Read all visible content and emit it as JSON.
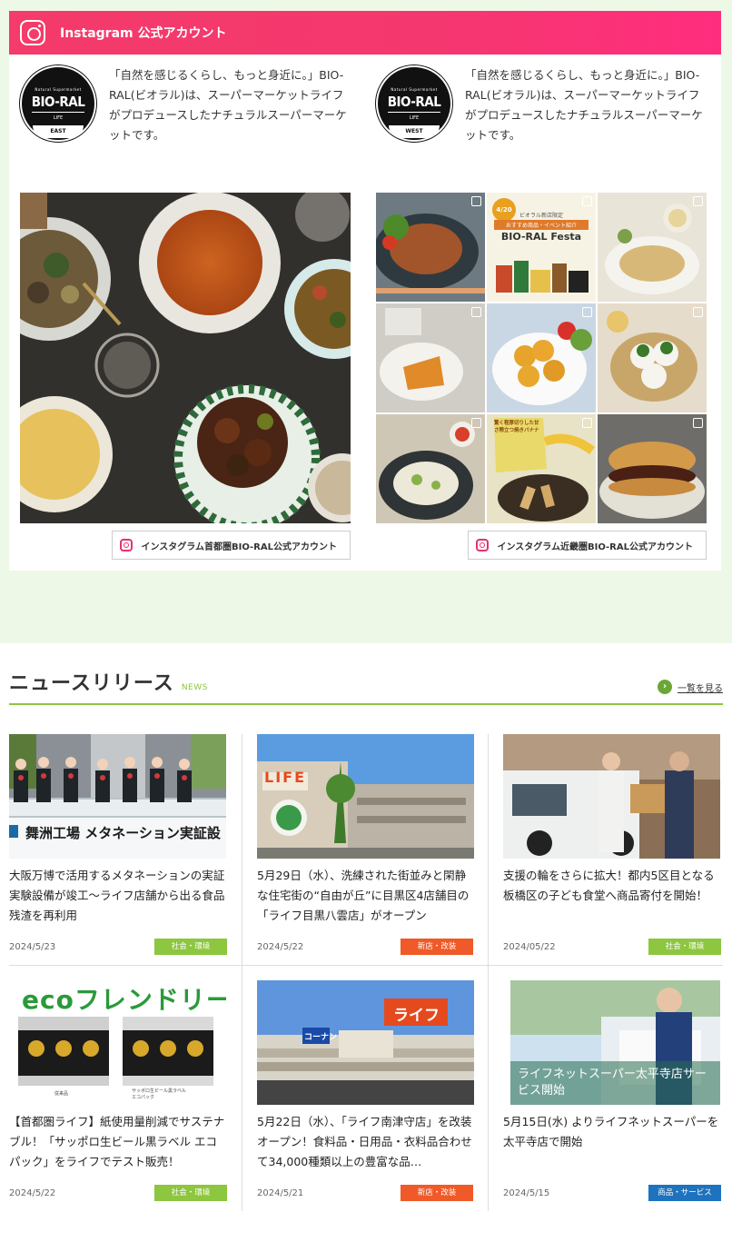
{
  "instagram": {
    "title": "Instagram 公式アカウント",
    "accounts": [
      {
        "logo_small": "Natural Supermarket",
        "logo_main": "BIO-RAL",
        "logo_life": "LIFE",
        "logo_tag": "EAST",
        "description": "「自然を感じるくらし、もっと身近に。」BIO-RAL(ビオラル)は、スーパーマーケットライフがプロデュースしたナチュラルスーパーマーケットです。",
        "link_label": "インスタグラム首都圏BIO-RAL公式アカウント"
      },
      {
        "logo_small": "Natural Supermarket",
        "logo_main": "BIO-RAL",
        "logo_life": "LIFE",
        "logo_tag": "WEST",
        "description": "「自然を感じるくらし、もっと身近に。」BIO-RAL(ビオラル)は、スーパーマーケットライフがプロデュースしたナチュラルスーパーマーケットです。",
        "link_label": "インスタグラム近畿圏BIO-RAL公式アカウント"
      }
    ],
    "festa": {
      "date": "4/20",
      "line1": "ビオラル新店限定",
      "line2": "おすすめ商品・イベント紹介",
      "name": "BIO-RAL Festa"
    },
    "banana_text": "驚く程厚切りした甘さ際立つ焼きバナナ"
  },
  "news": {
    "title": "ニュースリリース",
    "subtitle": "NEWS",
    "more_label": "一覧を見る",
    "items": [
      {
        "text": "大阪万博で活用するメタネーションの実証実験設備が竣工〜ライフ店舗から出る食品残渣を再利用",
        "date": "2024/5/23",
        "tag": "社会・環境",
        "image_text": "舞洲工場 メタネーション実証設"
      },
      {
        "text": "5月29日（水）、洗練された街並みと閑静な住宅街の“自由が丘”に目黒区4店舗目の「ライフ目黒八雲店」がオープン",
        "date": "2024/5/22",
        "tag": "新店・改装",
        "image_text": "LIFE"
      },
      {
        "text": "支援の輪をさらに拡大！都内5区目となる板橋区の子ども食堂へ商品寄付を開始！",
        "date": "2024/05/22",
        "tag": "社会・環境"
      },
      {
        "text": "【首都圏ライフ】紙使用量削減でサステナブル！「サッポロ生ビール黒ラベル エコパック」をライフでテスト販売！",
        "date": "2024/5/22",
        "tag": "社会・環境",
        "image_text": "ecoフレンドリー",
        "image_sub1": "従来品",
        "image_sub2": "サッポロ生ビール黒ラベル エコパック"
      },
      {
        "text": "5月22日（水）、「ライフ南津守店」を改装オープン！食料品・日用品・衣料品合わせて34,000種類以上の豊富な品…",
        "date": "2024/5/21",
        "tag": "新店・改装",
        "image_text": "ライフ",
        "image_sub1": "コーナン"
      },
      {
        "text": "5月15日(水) よりライフネットスーパーを太平寺店で開始",
        "date": "2024/5/15",
        "tag": "商品・サービス",
        "image_text": "ライフネットスーパー太平寺店サービス開始"
      }
    ]
  },
  "colors": {
    "instagram_gradient": "#f43b6a",
    "accent_green": "#8cc63f",
    "tag_env": "#8dc63f",
    "tag_store": "#ef5a28",
    "tag_service": "#1e73be",
    "bg_green": "#eef8e6"
  }
}
